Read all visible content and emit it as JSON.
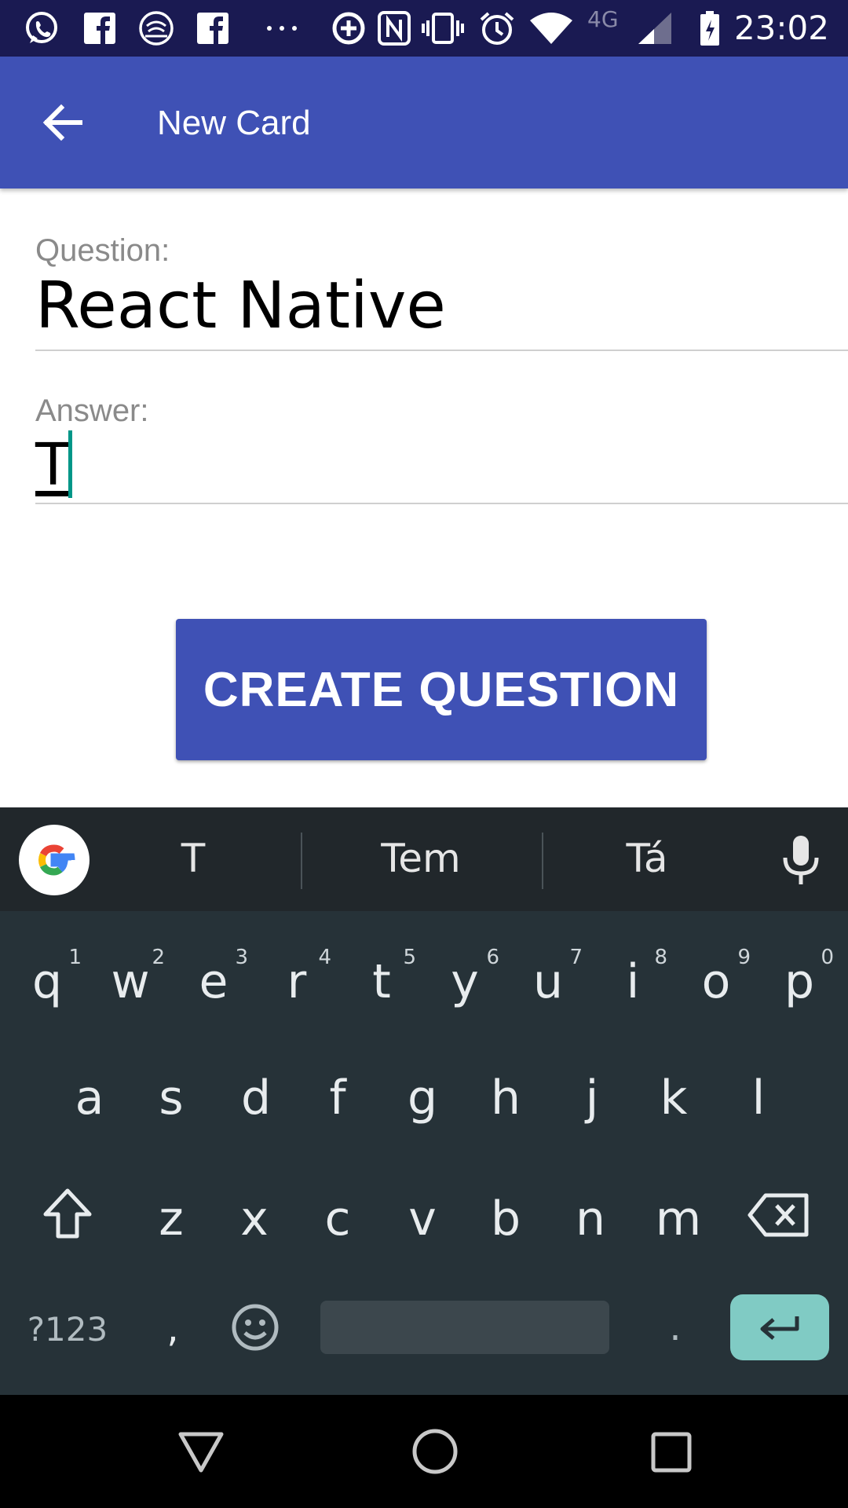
{
  "status_bar": {
    "time": "23:02",
    "network": "4G",
    "icons": [
      "whatsapp-icon",
      "facebook-icon",
      "wifi-call-icon",
      "facebook-icon",
      "more-dots-icon",
      "data-saver-icon",
      "nfc-icon",
      "vibrate-icon",
      "alarm-icon",
      "wifi-icon",
      "signal-icon",
      "battery-charging-icon"
    ]
  },
  "appbar": {
    "title": "New Card",
    "back_icon": "arrow-back-icon",
    "color": "#3f51b5"
  },
  "form": {
    "question_label": "Question:",
    "question_value": "React Native",
    "answer_label": "Answer:",
    "answer_value": "T",
    "cursor_color": "#009688"
  },
  "create_button": {
    "label": "CREATE QUESTION"
  },
  "keyboard": {
    "suggestions": [
      "T",
      "Tem",
      "Tá"
    ],
    "row1": [
      {
        "ch": "q",
        "sup": "1"
      },
      {
        "ch": "w",
        "sup": "2"
      },
      {
        "ch": "e",
        "sup": "3"
      },
      {
        "ch": "r",
        "sup": "4"
      },
      {
        "ch": "t",
        "sup": "5"
      },
      {
        "ch": "y",
        "sup": "6"
      },
      {
        "ch": "u",
        "sup": "7"
      },
      {
        "ch": "i",
        "sup": "8"
      },
      {
        "ch": "o",
        "sup": "9"
      },
      {
        "ch": "p",
        "sup": "0"
      }
    ],
    "row2": [
      "a",
      "s",
      "d",
      "f",
      "g",
      "h",
      "j",
      "k",
      "l"
    ],
    "row3": [
      "z",
      "x",
      "c",
      "v",
      "b",
      "n",
      "m"
    ],
    "symbols_label": "?123",
    "comma": ",",
    "period": ".",
    "enter_color": "#80cbc4"
  },
  "navbar": {
    "icons": [
      "back-triangle-icon",
      "home-circle-icon",
      "recents-square-icon"
    ]
  }
}
